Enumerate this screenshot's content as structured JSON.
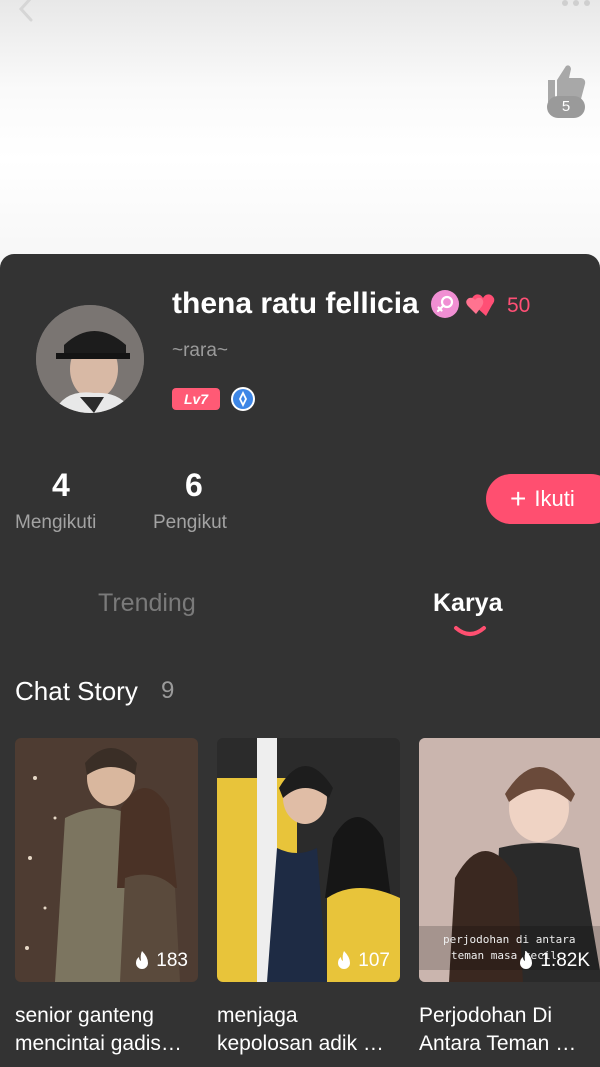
{
  "header": {
    "like_count": "5",
    "back_icon": "chevron-left-icon",
    "more_icon": "more-dots-icon",
    "like_icon": "thumbs-up-icon"
  },
  "profile": {
    "name": "thena ratu fellicia",
    "gender_icon": "female-icon",
    "hearts_icon": "hearts-icon",
    "hearts_count": "50",
    "bio": "~rara~",
    "level": "Lv7",
    "badge_icon": "medal-icon"
  },
  "stats": [
    {
      "value": "4",
      "label": "Mengikuti"
    },
    {
      "value": "6",
      "label": "Pengikut"
    }
  ],
  "follow_button": {
    "plus": "+",
    "label": "Ikuti"
  },
  "tabs": [
    {
      "label": "Trending",
      "active": false
    },
    {
      "label": "Karya",
      "active": true
    }
  ],
  "section": {
    "title": "Chat Story",
    "count": "9"
  },
  "stories": [
    {
      "plays": "183",
      "title_line1": "senior ganteng",
      "title_line2": "mencintai gadis…"
    },
    {
      "plays": "107",
      "title_line1": "menjaga",
      "title_line2": "kepolosan adik …"
    },
    {
      "plays": "1.82K",
      "title_line1": "Perjodohan Di",
      "title_line2": "Antara Teman …",
      "cover_text_line1": "perjodohan di antara",
      "cover_text_line2": "teman masa kecil"
    }
  ],
  "colors": {
    "accent": "#ff4f70",
    "panel": "#333333",
    "muted": "#9b9b9b"
  }
}
